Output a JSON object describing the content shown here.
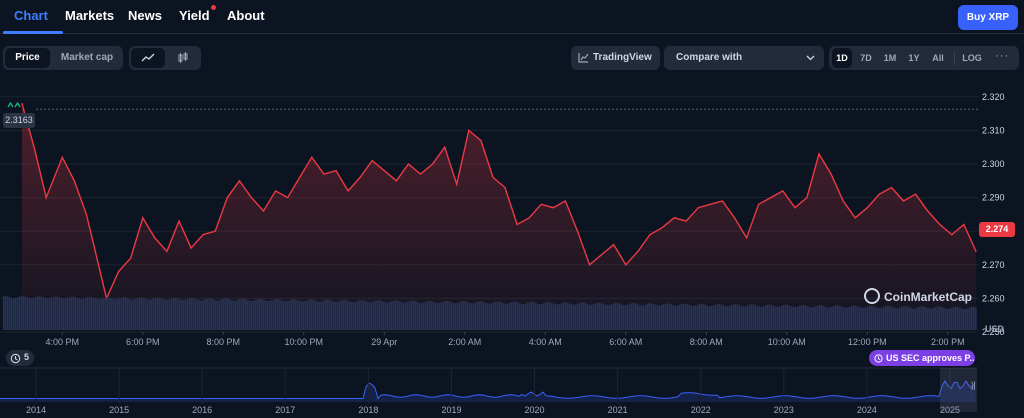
{
  "nav": {
    "tabs": [
      {
        "label": "Chart"
      },
      {
        "label": "Markets"
      },
      {
        "label": "News"
      },
      {
        "label": "Yield"
      },
      {
        "label": "About"
      }
    ],
    "buy_label": "Buy XRP"
  },
  "toolbar": {
    "price_label": "Price",
    "marketcap_label": "Market cap",
    "tradingview_label": "TradingView",
    "compare_placeholder": "Compare with",
    "ranges": [
      "1D",
      "7D",
      "1M",
      "1Y",
      "All"
    ],
    "active_range": "1D",
    "log_label": "LOG",
    "more_label": "···"
  },
  "colors": {
    "accent": "#3861fb",
    "price_line": "#ea3943",
    "event_pill": "#7b3fe4"
  },
  "icons": {
    "line_chart": "line-chart-icon",
    "candlestick": "candlestick-icon",
    "tradingview": "tradingview-icon",
    "chevron": "chevron-down-icon",
    "watermark": "coinmarketcap-logo-icon"
  },
  "chart": {
    "reference_price": "2.3163",
    "current_price": "2.274",
    "currency_label": "USD",
    "watermark": "CoinMarketCap",
    "events_count": "5",
    "event_label": "US SEC approves P..."
  },
  "chart_data": {
    "type": "line",
    "ylim": [
      2.25,
      2.325
    ],
    "y_ticks": [
      2.25,
      2.26,
      2.27,
      2.28,
      2.29,
      2.3,
      2.31,
      2.32
    ],
    "y_tick_labels": [
      "2.250",
      "2.260",
      "2.270",
      "2.280",
      "2.290",
      "2.300",
      "2.310",
      "2.320"
    ],
    "x_tick_labels": [
      "4:00 PM",
      "6:00 PM",
      "8:00 PM",
      "10:00 PM",
      "29 Apr",
      "2:00 AM",
      "4:00 AM",
      "6:00 AM",
      "8:00 AM",
      "10:00 AM",
      "12:00 PM",
      "2:00 PM"
    ],
    "x_range_hours": [
      0,
      23.7
    ],
    "series": [
      {
        "x": [
          0,
          0.3,
          0.6,
          1.0,
          1.3,
          1.6,
          1.8,
          2.1,
          2.4,
          2.7,
          3.0,
          3.3,
          3.6,
          3.9,
          4.2,
          4.5,
          4.8,
          5.1,
          5.4,
          5.7,
          6.0,
          6.3,
          6.6,
          6.9,
          7.2,
          7.5,
          7.8,
          8.1,
          8.4,
          8.7,
          9.0,
          9.3,
          9.6,
          9.9,
          10.2,
          10.5,
          10.8,
          11.1,
          11.4,
          11.7,
          12.0,
          12.3,
          12.6,
          12.9,
          13.2,
          13.5,
          13.8,
          14.1,
          14.4,
          14.7,
          15.0,
          15.3,
          15.6,
          15.9,
          16.2,
          16.5,
          16.8,
          17.1,
          17.4,
          17.7,
          18.0,
          18.3,
          18.6,
          18.9,
          19.2,
          19.5,
          19.8,
          20.1,
          20.4,
          20.7,
          21.0,
          21.3,
          21.6,
          21.9,
          22.2,
          22.5,
          22.8,
          23.1,
          23.4,
          23.7
        ],
        "y": [
          2.318,
          2.305,
          2.29,
          2.302,
          2.295,
          2.285,
          2.275,
          2.26,
          2.268,
          2.272,
          2.284,
          2.278,
          2.274,
          2.283,
          2.275,
          2.279,
          2.28,
          2.29,
          2.295,
          2.29,
          2.286,
          2.292,
          2.29,
          2.296,
          2.302,
          2.297,
          2.298,
          2.292,
          2.296,
          2.301,
          2.298,
          2.295,
          2.3,
          2.297,
          2.3,
          2.305,
          2.294,
          2.31,
          2.307,
          2.296,
          2.293,
          2.282,
          2.284,
          2.288,
          2.287,
          2.289,
          2.28,
          2.27,
          2.273,
          2.276,
          2.27,
          2.274,
          2.279,
          2.281,
          2.284,
          2.283,
          2.287,
          2.288,
          2.289,
          2.284,
          2.278,
          2.288,
          2.29,
          2.292,
          2.287,
          2.29,
          2.303,
          2.297,
          2.289,
          2.284,
          2.287,
          2.291,
          2.293,
          2.289,
          2.291,
          2.286,
          2.282,
          2.279,
          2.282,
          2.274
        ]
      }
    ]
  },
  "navigator": {
    "year_labels": [
      "2014",
      "2015",
      "2016",
      "2017",
      "2018",
      "2019",
      "2020",
      "2021",
      "2022",
      "2023",
      "2024",
      "2025"
    ]
  }
}
